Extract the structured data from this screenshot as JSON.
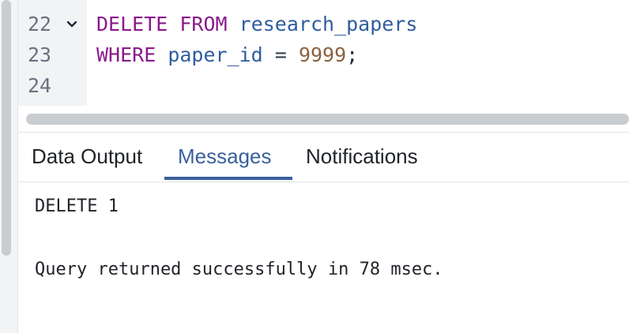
{
  "editor": {
    "lines": [
      {
        "number": "22",
        "fold": true,
        "tokens": [
          {
            "t": "DELETE",
            "c": "kw"
          },
          {
            "t": " ",
            "c": "punc"
          },
          {
            "t": "FROM",
            "c": "kw"
          },
          {
            "t": " ",
            "c": "punc"
          },
          {
            "t": "research_papers",
            "c": "id"
          }
        ]
      },
      {
        "number": "23",
        "fold": false,
        "tokens": [
          {
            "t": "WHERE",
            "c": "kw"
          },
          {
            "t": " ",
            "c": "punc"
          },
          {
            "t": "paper_id",
            "c": "id"
          },
          {
            "t": " ",
            "c": "punc"
          },
          {
            "t": "=",
            "c": "op"
          },
          {
            "t": " ",
            "c": "punc"
          },
          {
            "t": "9999",
            "c": "num"
          },
          {
            "t": ";",
            "c": "punc"
          }
        ]
      },
      {
        "number": "24",
        "fold": false,
        "tokens": []
      }
    ]
  },
  "tabs": [
    {
      "label": "Data Output",
      "active": false
    },
    {
      "label": "Messages",
      "active": true
    },
    {
      "label": "Notifications",
      "active": false
    }
  ],
  "messages": {
    "line1": "DELETE 1",
    "line2": "Query returned successfully in 78 msec."
  },
  "colors": {
    "keyword": "#8b1a8b",
    "identifier": "#2f5d9e",
    "number": "#8a6240",
    "active_tab": "#3a5f9c"
  }
}
